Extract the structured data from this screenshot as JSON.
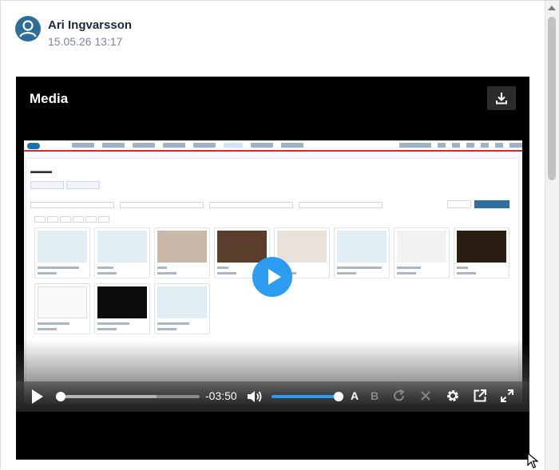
{
  "post": {
    "author": "Ari Ingvarsson",
    "timestamp": "15.05.26 13:17"
  },
  "player": {
    "title": "Media",
    "time_remaining": "-03:50",
    "progress": 0.0,
    "buffered": 0.69,
    "volume": 1.0,
    "caption_a_label": "A",
    "caption_b_label": "B"
  },
  "icons": {
    "avatar": "user-icon",
    "download": "download-icon",
    "play": "play-icon",
    "volume": "volume-icon",
    "redo": "redo-icon",
    "close": "close-icon",
    "settings": "gear-icon",
    "popout": "external-link-icon",
    "fullscreen": "fullscreen-icon"
  },
  "colors": {
    "accent": "#2c9cf0",
    "avatar": "#2c6d9a"
  }
}
